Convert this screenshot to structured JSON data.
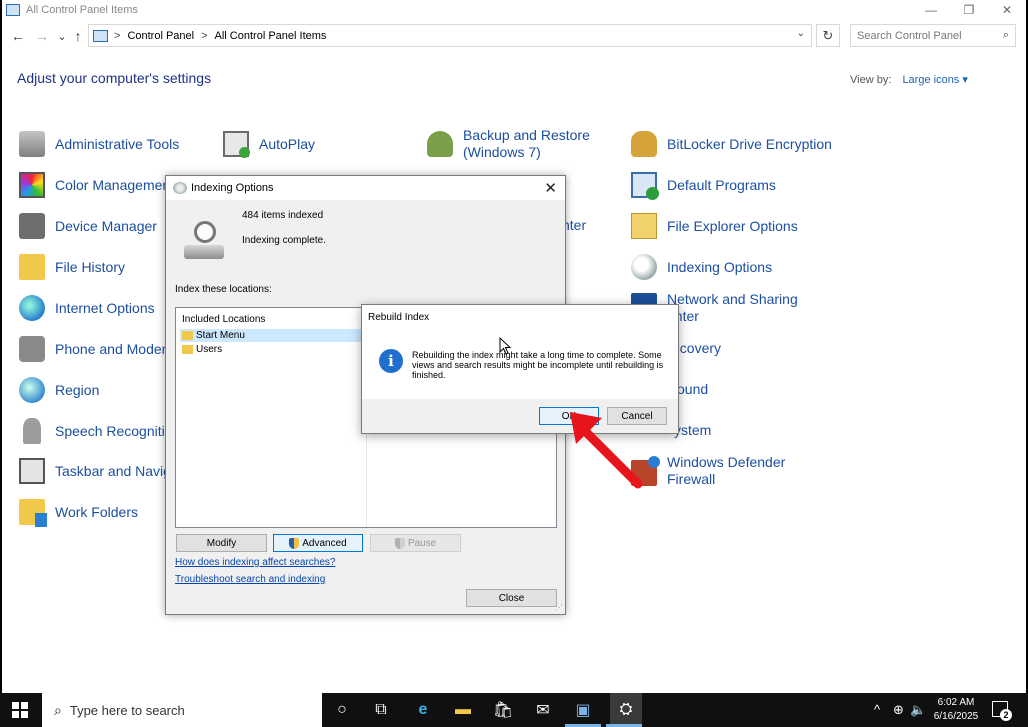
{
  "window": {
    "title": "All Control Panel Items",
    "controls": {
      "minimize": "—",
      "restore": "❐",
      "close": "✕"
    }
  },
  "nav": {
    "back": "←",
    "forward": "→",
    "recent": "⌄",
    "up": "↑",
    "breadcrumb": [
      "Control Panel",
      "All Control Panel Items"
    ],
    "separator": ">",
    "dropdown": "⌄",
    "refresh": "↻",
    "search_placeholder": "Search Control Panel",
    "search_icon": "⌕"
  },
  "header": {
    "title": "Adjust your computer's settings",
    "view_by_label": "View by:",
    "view_by_value": "Large icons",
    "view_by_arrow": "▾"
  },
  "control_panel_items": [
    {
      "label": "Administrative Tools",
      "icon": "admin-tools-icon"
    },
    {
      "label": "AutoPlay",
      "icon": "autoplay-icon"
    },
    {
      "label": "Backup and Restore (Windows 7)",
      "icon": "backup-icon"
    },
    {
      "label": "BitLocker Drive Encryption",
      "icon": "bitlocker-icon"
    },
    {
      "label": "Color Management",
      "icon": "color-management-icon"
    },
    {
      "label": "Default Programs",
      "icon": "default-programs-icon"
    },
    {
      "label": "Device Manager",
      "icon": "device-manager-icon"
    },
    {
      "label": "nter",
      "icon": ""
    },
    {
      "label": "File Explorer Options",
      "icon": "file-explorer-options-icon"
    },
    {
      "label": "File History",
      "icon": "file-history-icon"
    },
    {
      "label": "Indexing Options",
      "icon": "indexing-options-icon"
    },
    {
      "label": "Internet Options",
      "icon": "internet-options-icon"
    },
    {
      "label": "Network and Sharing",
      "label2": "enter",
      "icon": "network-icon"
    },
    {
      "label": "Phone and Modem",
      "icon": "phone-modem-icon"
    },
    {
      "label": "ecovery",
      "icon": "recovery-icon"
    },
    {
      "label": "Region",
      "icon": "region-icon"
    },
    {
      "label": "ound",
      "icon": "sound-icon"
    },
    {
      "label": "Speech Recognition",
      "icon": "speech-icon"
    },
    {
      "label": "ystem",
      "icon": "system-icon"
    },
    {
      "label": "Taskbar and Naviga",
      "icon": "taskbar-icon"
    },
    {
      "label": "Windows Defender",
      "label2": "Firewall",
      "icon": "defender-icon"
    },
    {
      "label": "Work Folders",
      "icon": "work-folders-icon"
    }
  ],
  "indexing_dialog": {
    "title": "Indexing Options",
    "close": "✕",
    "items_indexed": "484 items indexed",
    "status": "Indexing complete.",
    "locations_label": "Index these locations:",
    "column_header": "Included Locations",
    "locations": [
      "Start Menu",
      "Users"
    ],
    "buttons": {
      "modify": "Modify",
      "advanced": "Advanced",
      "pause": "Pause",
      "close": "Close"
    },
    "links": [
      "How does indexing affect searches?",
      "Troubleshoot search and indexing"
    ],
    "grip": "⋰"
  },
  "rebuild_dialog": {
    "title": "Rebuild Index",
    "info_glyph": "i",
    "message": "Rebuilding the index might take a long time to complete. Some views and search results might be incomplete until rebuilding is finished.",
    "ok": "OK",
    "cancel": "Cancel"
  },
  "taskbar": {
    "search_placeholder": "Type here to search",
    "search_icon": "⌕",
    "cortana": "○",
    "task_view": "⧉",
    "edge": "e",
    "explorer": "▬",
    "store": "🛍",
    "mail": "✉",
    "control_panel": "▣",
    "indexing": "⛭",
    "tray_chevron": "^",
    "network": "⊕",
    "volume": "🔈",
    "time": "6:02 AM",
    "date": "6/16/2025",
    "notifications": "2"
  },
  "colors": {
    "link": "#1c4fa0",
    "heading": "#1e3287",
    "annotation_arrow": "#e8141b",
    "focus": "#0078d7"
  }
}
